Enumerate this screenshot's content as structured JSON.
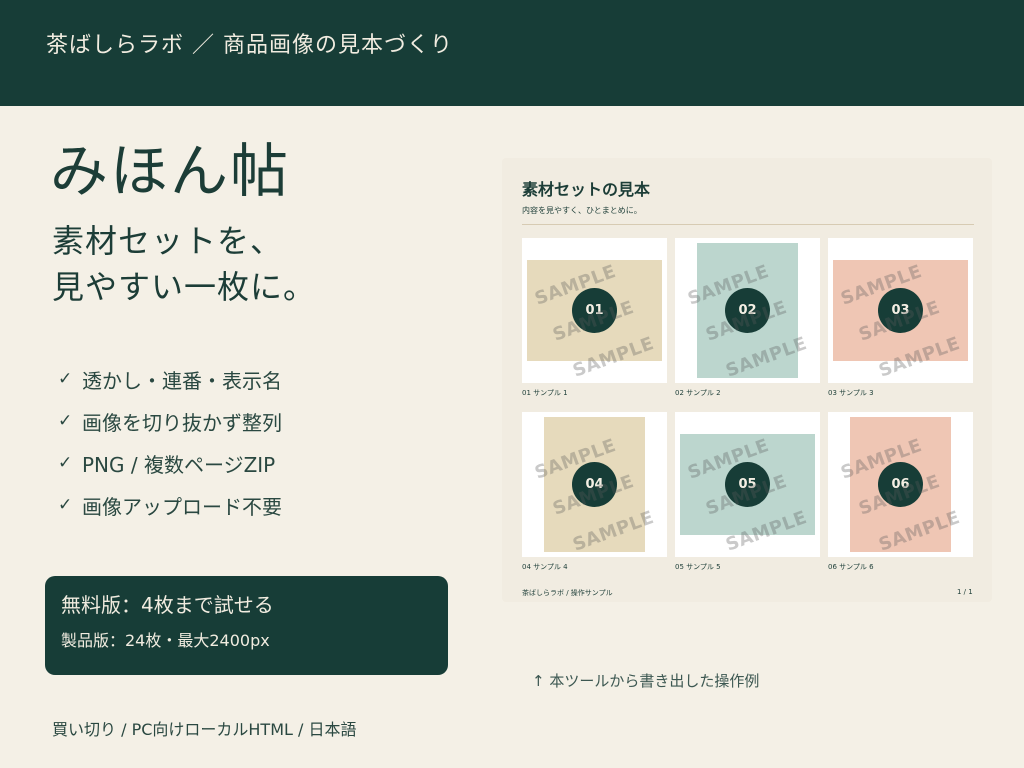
{
  "header": {
    "title": "茶ばしらラボ ／ 商品画像の見本づくり"
  },
  "main": {
    "title": "みほん帖",
    "subtitle_line1": "素材セットを、",
    "subtitle_line2": "見やすい一枚に。",
    "features": [
      {
        "check": "✓",
        "text": "透かし・連番・表示名"
      },
      {
        "check": "✓",
        "text": "画像を切り抜かず整列"
      },
      {
        "check": "✓",
        "text": "PNG / 複数ページZIP"
      },
      {
        "check": "✓",
        "text": "画像アップロード不要"
      }
    ]
  },
  "pricing": {
    "free": "無料版：4枚まで試せる",
    "paid": "製品版：24枚・最大2400px"
  },
  "footer_note": "買い切り / PC向けローカルHTML / 日本語",
  "caption": "↑ 本ツールから書き出した操作例",
  "sample_sheet": {
    "title": "素材セットの見本",
    "subtitle": "内容を見やすく、ひとまとめに。",
    "watermark": "SAMPLE",
    "items": [
      {
        "number": "01",
        "label": "01  サンプル 1",
        "color": "#e6dabc"
      },
      {
        "number": "02",
        "label": "02  サンプル 2",
        "color": "#bcd6ce"
      },
      {
        "number": "03",
        "label": "03  サンプル 3",
        "color": "#efc6b4"
      },
      {
        "number": "04",
        "label": "04  サンプル 4",
        "color": "#e6dabc"
      },
      {
        "number": "05",
        "label": "05  サンプル 5",
        "color": "#bcd6ce"
      },
      {
        "number": "06",
        "label": "06  サンプル 6",
        "color": "#efc6b4"
      }
    ],
    "footer_left": "茶ばしらラボ / 操作サンプル",
    "footer_right": "1 / 1"
  },
  "colors": {
    "primary": "#173d37",
    "background": "#f4f0e6",
    "beige": "#e6dabc",
    "sage": "#bcd6ce",
    "peach": "#efc6b4"
  }
}
